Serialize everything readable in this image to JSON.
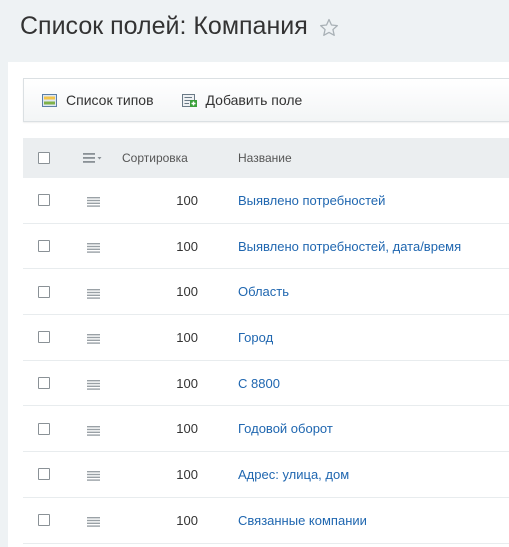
{
  "page": {
    "title": "Список полей: Компания",
    "favorite_icon": "star-outline-icon"
  },
  "toolbar": {
    "types_list_label": "Список типов",
    "types_list_icon": "list-types-icon",
    "add_field_label": "Добавить поле",
    "add_field_icon": "add-field-icon"
  },
  "grid": {
    "columns": {
      "sort": "Сортировка",
      "name": "Название"
    },
    "rows": [
      {
        "sort": "100",
        "name": "Выявлено потребностей"
      },
      {
        "sort": "100",
        "name": "Выявлено потребностей, дата/время"
      },
      {
        "sort": "100",
        "name": "Область"
      },
      {
        "sort": "100",
        "name": "Город"
      },
      {
        "sort": "100",
        "name": "С 8800"
      },
      {
        "sort": "100",
        "name": "Годовой оборот"
      },
      {
        "sort": "100",
        "name": "Адрес: улица, дом"
      },
      {
        "sort": "100",
        "name": "Связанные компании"
      }
    ]
  },
  "colors": {
    "link": "#2067b0",
    "header_bg": "#ebeef0",
    "page_bg": "#eef2f4"
  }
}
